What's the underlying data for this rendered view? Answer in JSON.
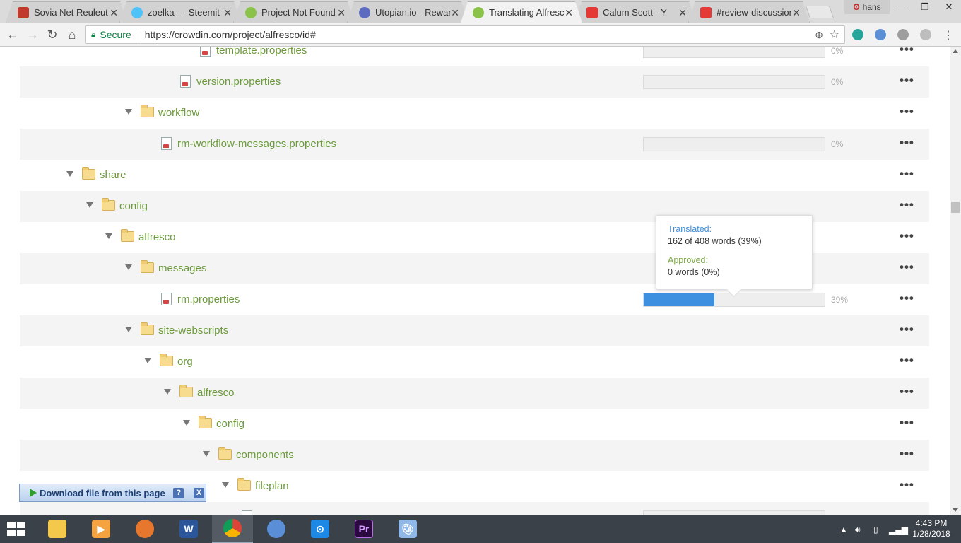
{
  "browser": {
    "tabs": [
      {
        "title": "Sovia Net Reuleut",
        "color": "#c0392b"
      },
      {
        "title": "zoelka — Steemit",
        "color": "#4fc3f7"
      },
      {
        "title": "Project Not Found",
        "color": "#8bc34a"
      },
      {
        "title": "Utopian.io - Rewar",
        "color": "#5c6bc0"
      },
      {
        "title": "Translating Alfresc",
        "color": "#8bc34a"
      },
      {
        "title": "Calum Scott - Y",
        "color": "#e53935"
      },
      {
        "title": "#review-discussion",
        "color": "#e53935"
      }
    ],
    "active_tab": 4,
    "profile_name": "hans",
    "secure_label": "Secure",
    "url": "https://crowdin.com/project/alfresco/id#"
  },
  "tree": {
    "rows": [
      {
        "type": "file",
        "name": "template.properties",
        "percent": 0,
        "percent_label": "0%"
      },
      {
        "type": "file",
        "name": "version.properties",
        "percent": 0,
        "percent_label": "0%"
      },
      {
        "type": "folder",
        "name": "workflow"
      },
      {
        "type": "file",
        "name": "rm-workflow-messages.properties",
        "percent": 0,
        "percent_label": "0%"
      },
      {
        "type": "folder",
        "name": "share"
      },
      {
        "type": "folder",
        "name": "config"
      },
      {
        "type": "folder",
        "name": "alfresco"
      },
      {
        "type": "folder",
        "name": "messages"
      },
      {
        "type": "file",
        "name": "rm.properties",
        "percent": 39,
        "percent_label": "39%"
      },
      {
        "type": "folder",
        "name": "site-webscripts"
      },
      {
        "type": "folder",
        "name": "org"
      },
      {
        "type": "folder",
        "name": "alfresco"
      },
      {
        "type": "folder",
        "name": "config"
      },
      {
        "type": "folder",
        "name": "components"
      },
      {
        "type": "folder",
        "name": "fileplan"
      },
      {
        "type": "file",
        "name": "",
        "percent": 0,
        "percent_label": ""
      }
    ],
    "more_label": "•••"
  },
  "tooltip": {
    "translated_label": "Translated:",
    "translated_value": "162 of 408 words (39%)",
    "approved_label": "Approved:",
    "approved_value": "0 words (0%)"
  },
  "download_helper": {
    "label": "Download file from this page",
    "help": "?",
    "close": "X"
  },
  "taskbar": {
    "apps": [
      "file-explorer",
      "media-player",
      "firefox",
      "word",
      "chrome",
      "chromium",
      "vpn",
      "premiere",
      "paint"
    ],
    "active_app": 4,
    "time": "4:43 PM",
    "date": "1/28/2018"
  }
}
